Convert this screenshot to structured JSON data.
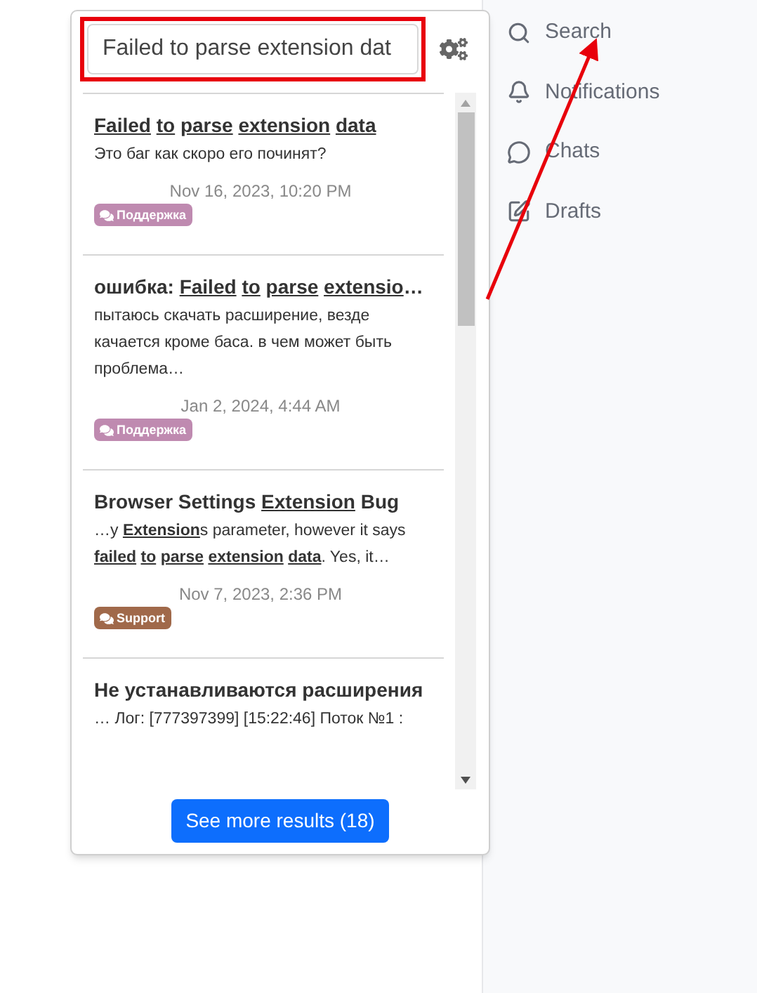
{
  "search": {
    "value": "Failed to parse extension dat"
  },
  "results": [
    {
      "title": "**Failed** **to** **parse** **extension** **data**",
      "excerpt": "Это баг как скоро его починят?",
      "date": "Nov 16, 2023, 10:20 PM",
      "tag": {
        "label": "Поддержка",
        "color": "#bf8ab0"
      }
    },
    {
      "title": "ошибка: **Failed** **to** **parse** **extensio**…",
      "excerpt": "пытаюсь скачать расширение, везде качается кроме баса. в чем может быть проблема…",
      "date": "Jan 2, 2024, 4:44 AM",
      "tag": {
        "label": "Поддержка",
        "color": "#bf8ab0"
      }
    },
    {
      "title": "Browser Settings **Extension** Bug",
      "excerpt": "…y **Extension**s parameter, however it says **failed** **to** **parse** **extension** **data**. Yes, it…",
      "date": "Nov 7, 2023, 2:36 PM",
      "tag": {
        "label": "Support",
        "color": "#a0694a"
      }
    },
    {
      "title": "Не устанавливаются расширения",
      "excerpt": "… Лог: [777397399] [15:22:46] Поток №1 :"
    }
  ],
  "more_button": "See more results (18)",
  "sidebar": [
    {
      "kind": "search",
      "label": "Search"
    },
    {
      "kind": "bell",
      "label": "Notifications"
    },
    {
      "kind": "chat",
      "label": "Chats"
    },
    {
      "kind": "edit",
      "label": "Drafts"
    }
  ]
}
